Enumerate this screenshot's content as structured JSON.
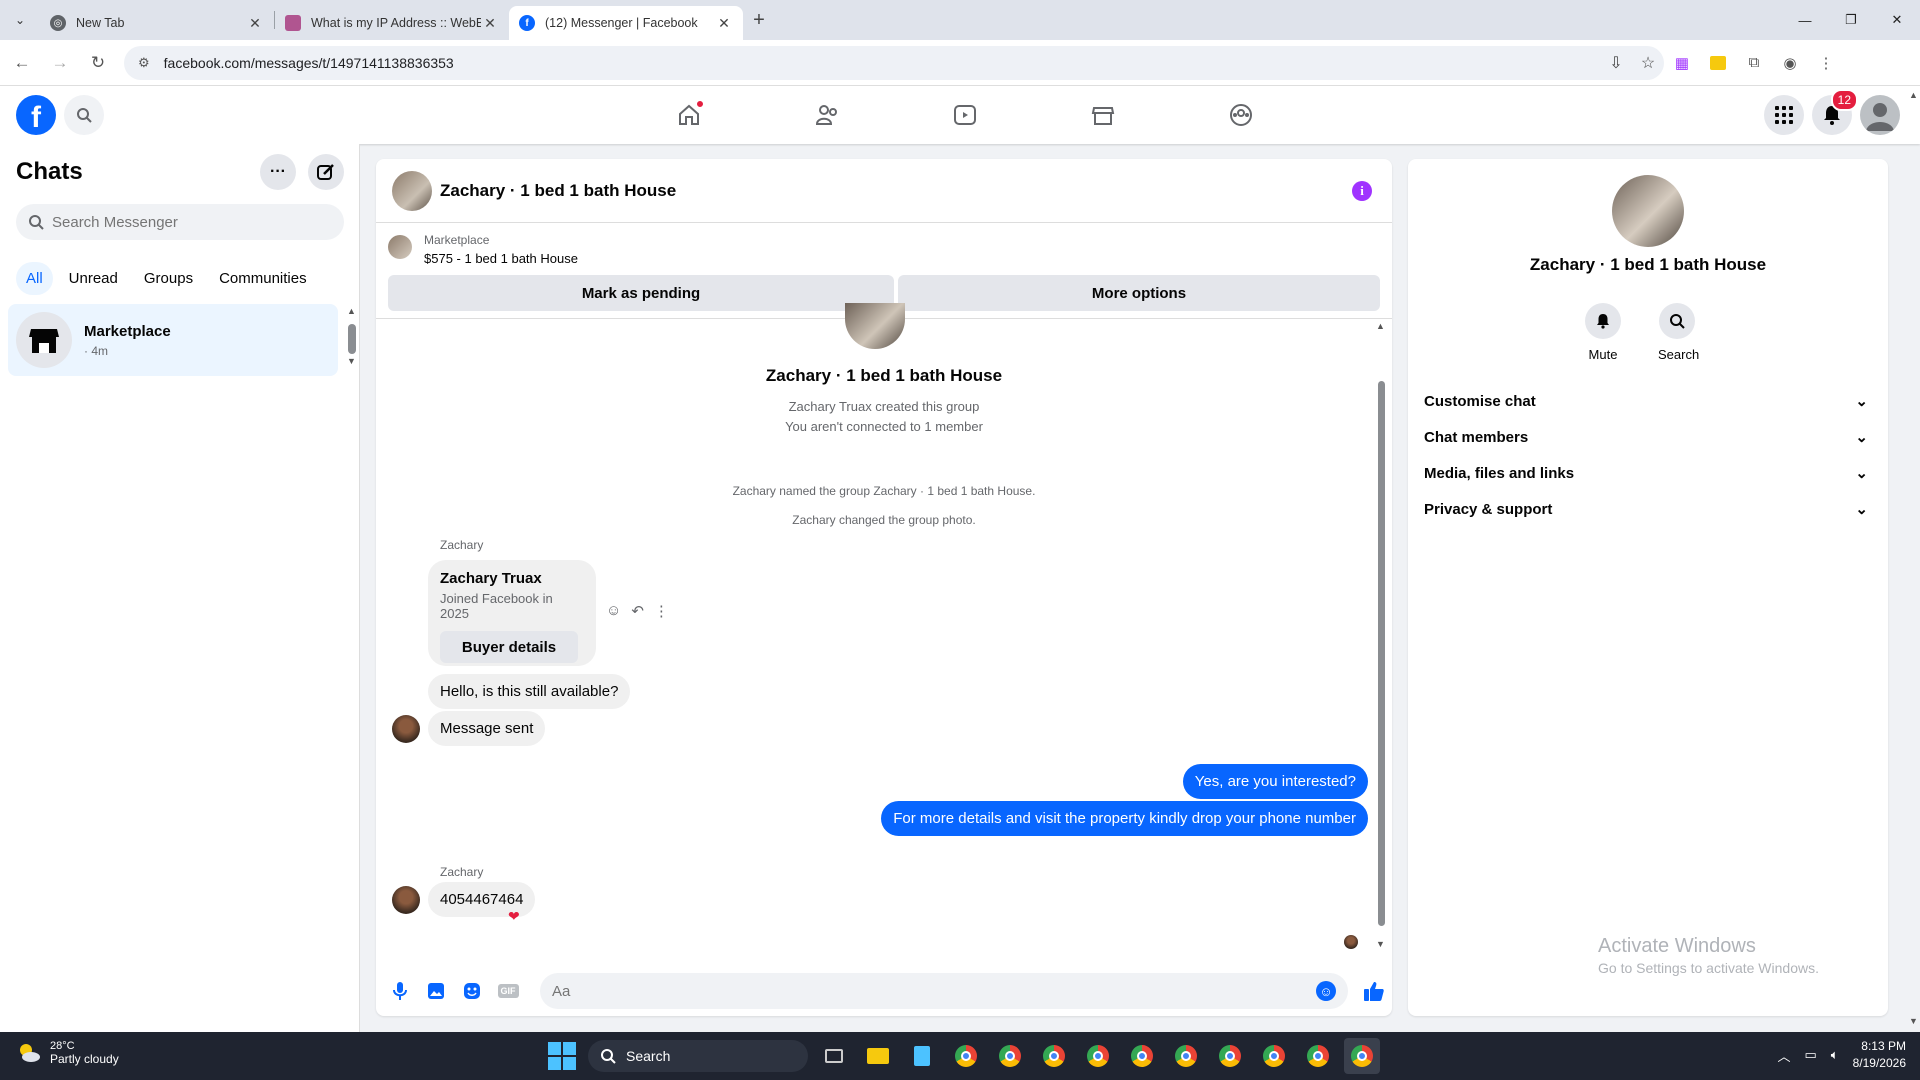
{
  "browser": {
    "tabs": [
      {
        "title": "New Tab",
        "active": false
      },
      {
        "title": "What is my IP Address :: WebBr",
        "active": false
      },
      {
        "title": "(12) Messenger | Facebook",
        "active": true
      }
    ],
    "url": "facebook.com/messages/t/1497141138836353"
  },
  "fb": {
    "notifications_badge": "12"
  },
  "sidebar": {
    "title": "Chats",
    "search_placeholder": "Search Messenger",
    "filters": [
      "All",
      "Unread",
      "Groups",
      "Communities"
    ],
    "chats": [
      {
        "name": "Marketplace",
        "meta": "· 4m"
      }
    ]
  },
  "chat": {
    "title": "Zachary · 1 bed 1 bath House",
    "marketplace_label": "Marketplace",
    "listing": "$575 - 1 bed 1 bath House",
    "mark_pending": "Mark as pending",
    "more_options": "More options",
    "group_title": "Zachary · 1 bed 1 bath House",
    "created_by": "Zachary Truax created this group",
    "not_connected": "You aren't connected to 1 member",
    "sys_named": "Zachary named the group Zachary · 1 bed 1 bath House.",
    "sys_photo": "Zachary changed the group photo.",
    "sender1": "Zachary",
    "card_name": "Zachary Truax",
    "card_sub": "Joined Facebook in 2025",
    "card_button": "Buyer details",
    "msg_available": "Hello, is this still available?",
    "msg_sent": "Message sent",
    "my_msg1": "Yes, are you interested?",
    "my_msg2": "For more details and visit the property kindly drop your phone number",
    "sender2": "Zachary",
    "msg_phone": "4054467464",
    "composer_placeholder": "Aa"
  },
  "info": {
    "name": "Zachary · 1 bed 1 bath House",
    "mute": "Mute",
    "search": "Search",
    "sections": [
      "Customise chat",
      "Chat members",
      "Media, files and links",
      "Privacy & support"
    ],
    "watermark_1": "Activate Windows",
    "watermark_2": "Go to Settings to activate Windows."
  },
  "taskbar": {
    "temp": "28°C",
    "weather": "Partly cloudy",
    "search": "Search",
    "time": "8:13 PM",
    "date": "8/19/2026"
  },
  "colors": {
    "accent": "#0866ff",
    "my_bubble": "#0866ff",
    "badge": "#e41e3f",
    "info_icon": "#a033ff"
  }
}
